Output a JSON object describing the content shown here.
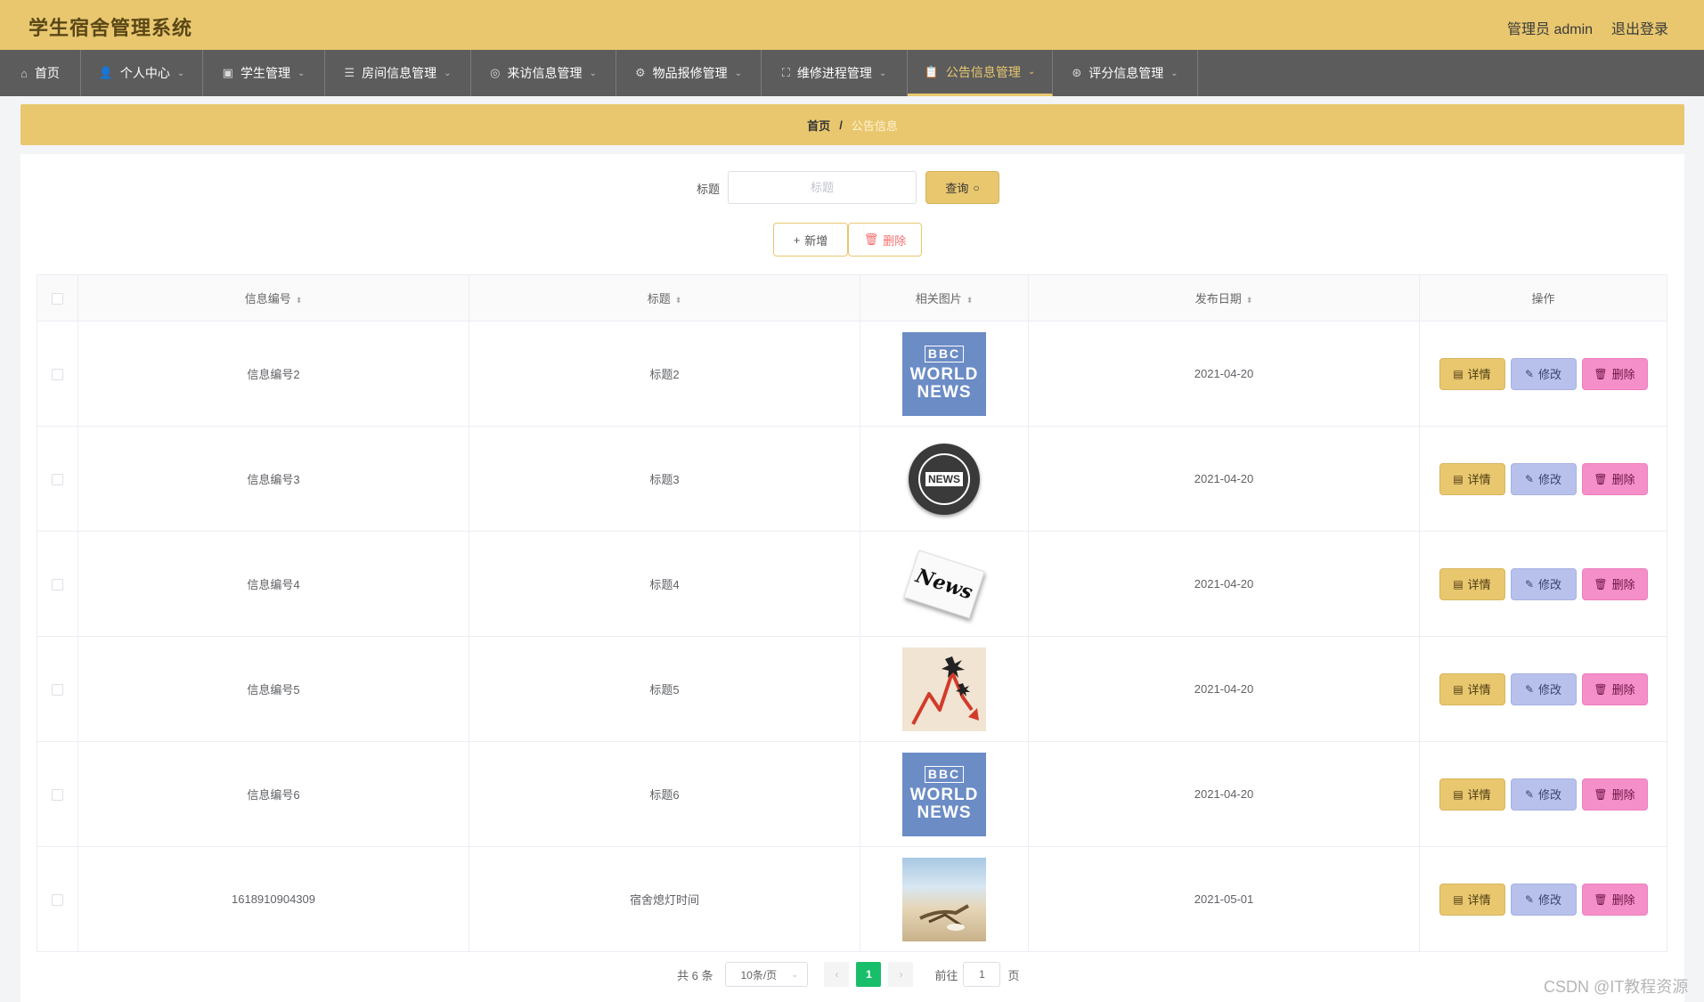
{
  "app": {
    "title": "学生宿舍管理系统",
    "user_label": "管理员 admin",
    "logout": "退出登录"
  },
  "nav": [
    {
      "label": "首页",
      "icon": "home-icon",
      "has_caret": false
    },
    {
      "label": "个人中心",
      "icon": "user-icon",
      "has_caret": true
    },
    {
      "label": "学生管理",
      "icon": "chart-icon",
      "has_caret": true
    },
    {
      "label": "房间信息管理",
      "icon": "list-icon",
      "has_caret": true
    },
    {
      "label": "来访信息管理",
      "icon": "compass-icon",
      "has_caret": true
    },
    {
      "label": "物品报修管理",
      "icon": "settings-icon",
      "has_caret": true
    },
    {
      "label": "维修进程管理",
      "icon": "fullscreen-icon",
      "has_caret": true
    },
    {
      "label": "公告信息管理",
      "icon": "clipboard-icon",
      "has_caret": true,
      "active": true
    },
    {
      "label": "评分信息管理",
      "icon": "help-icon",
      "has_caret": true
    }
  ],
  "breadcrumb": {
    "home": "首页",
    "separator": "/",
    "current": "公告信息"
  },
  "search": {
    "label": "标题",
    "placeholder": "标题",
    "value": "",
    "button": "查询"
  },
  "actions": {
    "add": "新增",
    "delete": "删除"
  },
  "table": {
    "columns": [
      "信息编号",
      "标题",
      "相关图片",
      "发布日期",
      "操作"
    ],
    "rows": [
      {
        "id": "信息编号2",
        "title": "标题2",
        "image": "bbc-world-news",
        "date": "2021-04-20"
      },
      {
        "id": "信息编号3",
        "title": "标题3",
        "image": "news-globe",
        "date": "2021-04-20"
      },
      {
        "id": "信息编号4",
        "title": "标题4",
        "image": "news-paper",
        "date": "2021-04-20"
      },
      {
        "id": "信息编号5",
        "title": "标题5",
        "image": "trend-chart",
        "date": "2021-04-20"
      },
      {
        "id": "信息编号6",
        "title": "标题6",
        "image": "bbc-world-news",
        "date": "2021-04-20"
      },
      {
        "id": "1618910904309",
        "title": "宿舍熄灯时间",
        "image": "beach-photo",
        "date": "2021-05-01"
      }
    ],
    "row_actions": {
      "detail": "详情",
      "edit": "修改",
      "delete": "删除"
    }
  },
  "images": {
    "bbc": {
      "logo": "BBC",
      "line1": "WORLD",
      "line2": "NEWS"
    },
    "globe_text": "NEWS",
    "paper_text": "News"
  },
  "pagination": {
    "total": "共 6 条",
    "page_size": "10条/页",
    "current_page": "1",
    "goto_label": "前往",
    "goto_value": "1",
    "page_unit": "页"
  },
  "watermark": "CSDN @IT教程资源",
  "colors": {
    "brand": "#e8c76f",
    "nav_bg": "#5c5c5c",
    "edit": "#b8c1ec",
    "delete": "#f58fc9",
    "page_active": "#19be6b"
  }
}
